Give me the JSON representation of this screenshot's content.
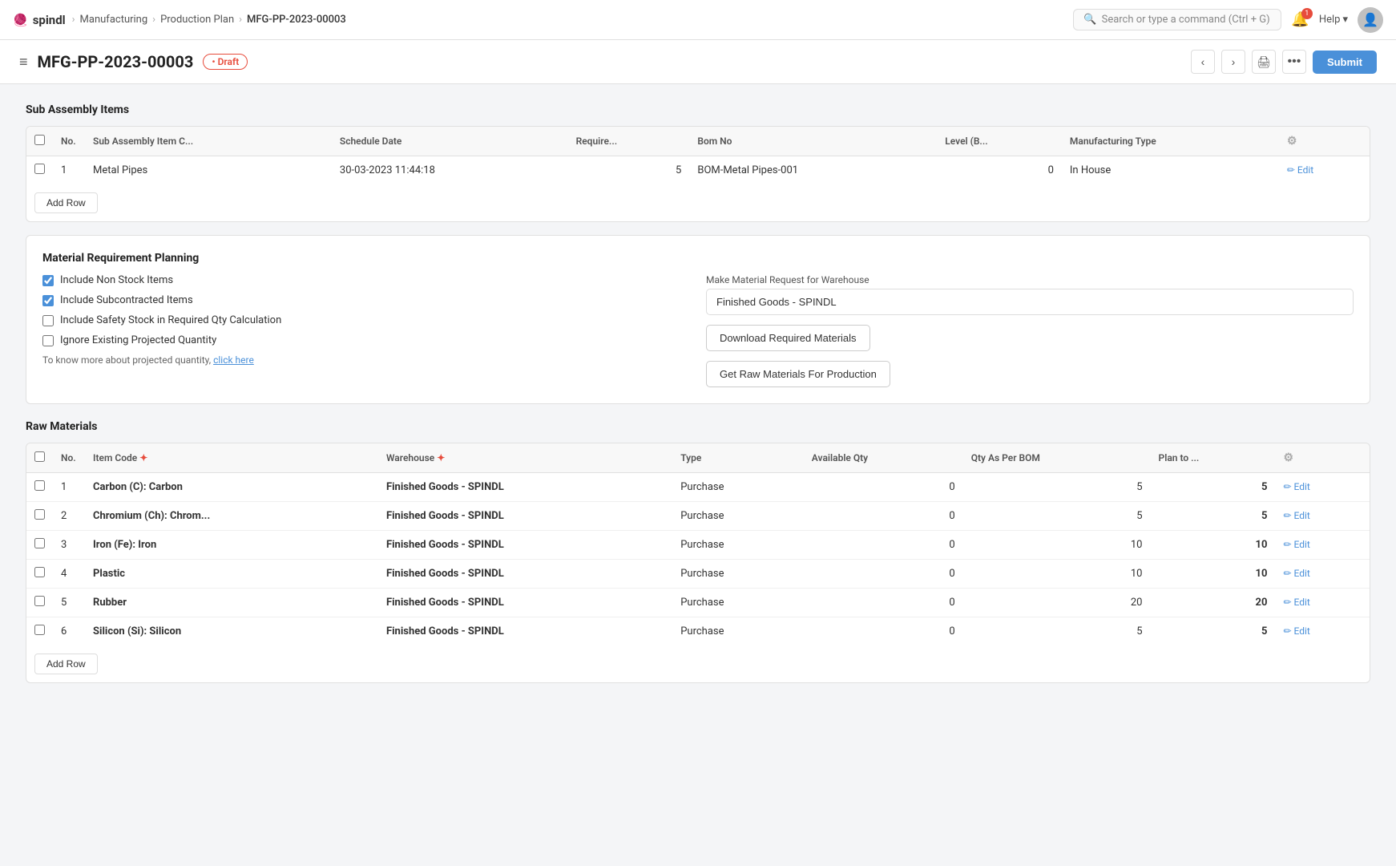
{
  "navbar": {
    "brand": "spindl",
    "logo": "🧶",
    "breadcrumbs": [
      "Manufacturing",
      "Production Plan",
      "MFG-PP-2023-00003"
    ],
    "search_placeholder": "Search or type a command (Ctrl + G)",
    "help_label": "Help",
    "notification_count": "1"
  },
  "page_header": {
    "doc_id": "MFG-PP-2023-00003",
    "status": "Draft",
    "submit_label": "Submit"
  },
  "sub_assembly": {
    "section_title": "Sub Assembly Items",
    "columns": [
      "No.",
      "Sub Assembly Item C...",
      "Schedule Date",
      "Require...",
      "Bom No",
      "Level (B...",
      "Manufacturing Type"
    ],
    "rows": [
      {
        "no": "1",
        "item_code": "Metal Pipes",
        "schedule_date": "30-03-2023 11:44:18",
        "required": "5",
        "bom_no": "BOM-Metal Pipes-001",
        "level": "0",
        "manufacturing_type": "In House"
      }
    ],
    "add_row_label": "Add Row"
  },
  "mrp": {
    "section_title": "Material Requirement Planning",
    "checkboxes": [
      {
        "label": "Include Non Stock Items",
        "checked": true
      },
      {
        "label": "Include Subcontracted Items",
        "checked": true
      },
      {
        "label": "Include Safety Stock in Required Qty Calculation",
        "checked": false
      },
      {
        "label": "Ignore Existing Projected Quantity",
        "checked": false
      }
    ],
    "projected_qty_text": "To know more about projected quantity,",
    "click_here_label": "click here",
    "warehouse_label": "Make Material Request for Warehouse",
    "warehouse_value": "Finished Goods - SPINDL",
    "download_btn": "Download Required Materials",
    "get_raw_btn": "Get Raw Materials For Production"
  },
  "raw_materials": {
    "section_title": "Raw Materials",
    "columns": [
      "No.",
      "Item Code",
      "Warehouse",
      "Type",
      "Available Qty",
      "Qty As Per BOM",
      "Plan to ..."
    ],
    "rows": [
      {
        "no": "1",
        "item_code": "Carbon (C): Carbon",
        "warehouse": "Finished Goods - SPINDL",
        "type": "Purchase",
        "available_qty": "0",
        "qty_bom": "5",
        "plan_to": "5"
      },
      {
        "no": "2",
        "item_code": "Chromium (Ch): Chrom...",
        "warehouse": "Finished Goods - SPINDL",
        "type": "Purchase",
        "available_qty": "0",
        "qty_bom": "5",
        "plan_to": "5"
      },
      {
        "no": "3",
        "item_code": "Iron (Fe): Iron",
        "warehouse": "Finished Goods - SPINDL",
        "type": "Purchase",
        "available_qty": "0",
        "qty_bom": "10",
        "plan_to": "10"
      },
      {
        "no": "4",
        "item_code": "Plastic",
        "warehouse": "Finished Goods - SPINDL",
        "type": "Purchase",
        "available_qty": "0",
        "qty_bom": "10",
        "plan_to": "10"
      },
      {
        "no": "5",
        "item_code": "Rubber",
        "warehouse": "Finished Goods - SPINDL",
        "type": "Purchase",
        "available_qty": "0",
        "qty_bom": "20",
        "plan_to": "20"
      },
      {
        "no": "6",
        "item_code": "Silicon (Si): Silicon",
        "warehouse": "Finished Goods - SPINDL",
        "type": "Purchase",
        "available_qty": "0",
        "qty_bom": "5",
        "plan_to": "5"
      }
    ],
    "add_row_label": "Add Row"
  }
}
